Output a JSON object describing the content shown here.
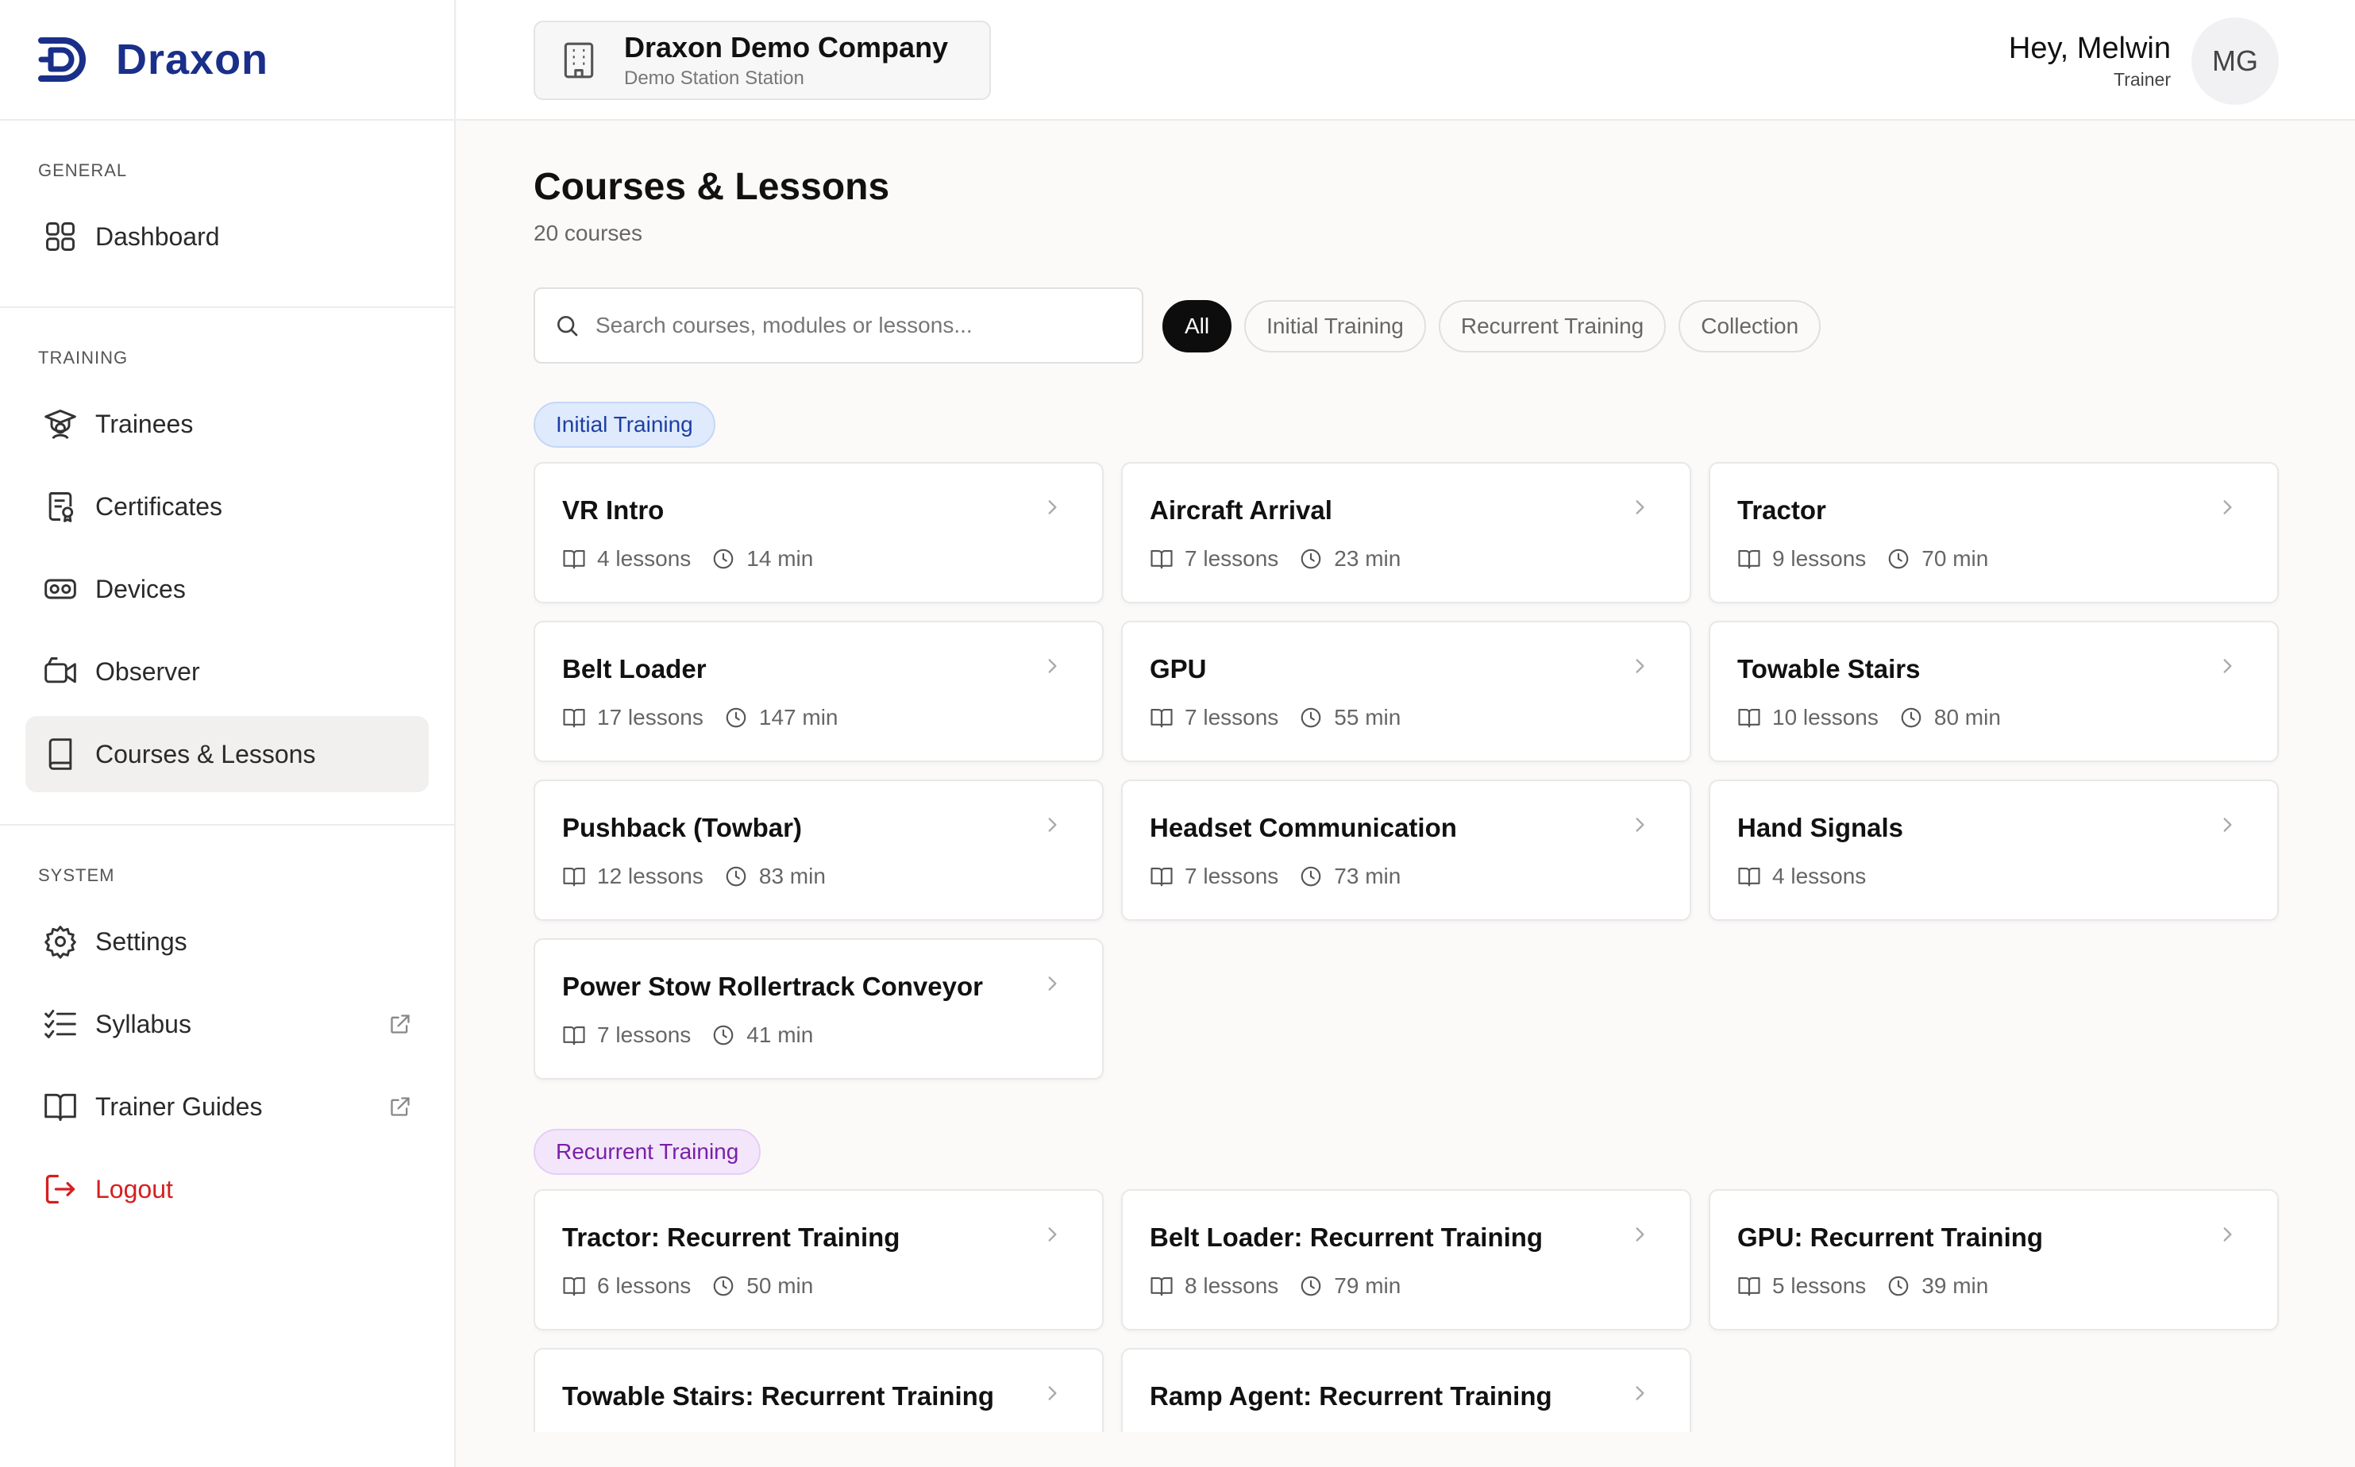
{
  "brand": {
    "name": "Draxon",
    "color": "#1a2f8a"
  },
  "sidebar": {
    "sections": [
      {
        "label": "GENERAL",
        "items": [
          {
            "label": "Dashboard",
            "icon": "grid-icon"
          }
        ]
      },
      {
        "label": "TRAINING",
        "items": [
          {
            "label": "Trainees",
            "icon": "graduation-icon"
          },
          {
            "label": "Certificates",
            "icon": "certificate-icon"
          },
          {
            "label": "Devices",
            "icon": "vr-headset-icon"
          },
          {
            "label": "Observer",
            "icon": "video-camera-icon"
          },
          {
            "label": "Courses & Lessons",
            "icon": "book-icon",
            "active": true
          }
        ]
      },
      {
        "label": "SYSTEM",
        "items": [
          {
            "label": "Settings",
            "icon": "gear-icon"
          },
          {
            "label": "Syllabus",
            "icon": "checklist-icon",
            "external": true
          },
          {
            "label": "Trainer Guides",
            "icon": "open-book-icon",
            "external": true
          },
          {
            "label": "Logout",
            "icon": "logout-icon"
          }
        ]
      }
    ]
  },
  "header": {
    "company_name": "Draxon Demo Company",
    "company_sub": "Demo Station Station",
    "greeting": "Hey, Melwin",
    "role": "Trainer",
    "avatar_initials": "MG"
  },
  "main": {
    "title": "Courses & Lessons",
    "subtitle": "20 courses",
    "search_placeholder": "Search courses, modules or lessons...",
    "filters": [
      "All",
      "Initial Training",
      "Recurrent Training",
      "Collection"
    ],
    "active_filter": "All",
    "groups": [
      {
        "label": "Initial Training",
        "courses": [
          {
            "title": "VR Intro",
            "lessons": "4 lessons",
            "duration": "14 min"
          },
          {
            "title": "Aircraft Arrival",
            "lessons": "7 lessons",
            "duration": "23 min"
          },
          {
            "title": "Tractor",
            "lessons": "9 lessons",
            "duration": "70 min"
          },
          {
            "title": "Belt Loader",
            "lessons": "17 lessons",
            "duration": "147 min"
          },
          {
            "title": "GPU",
            "lessons": "7 lessons",
            "duration": "55 min"
          },
          {
            "title": "Towable Stairs",
            "lessons": "10 lessons",
            "duration": "80 min"
          },
          {
            "title": "Pushback (Towbar)",
            "lessons": "12 lessons",
            "duration": "83 min"
          },
          {
            "title": "Headset Communication",
            "lessons": "7 lessons",
            "duration": "73 min"
          },
          {
            "title": "Hand Signals",
            "lessons": "4 lessons",
            "duration": ""
          },
          {
            "title": "Power Stow Rollertrack Conveyor",
            "lessons": "7 lessons",
            "duration": "41 min"
          }
        ]
      },
      {
        "label": "Recurrent Training",
        "courses": [
          {
            "title": "Tractor: Recurrent Training",
            "lessons": "6 lessons",
            "duration": "50 min"
          },
          {
            "title": "Belt Loader: Recurrent Training",
            "lessons": "8 lessons",
            "duration": "79 min"
          },
          {
            "title": "GPU: Recurrent Training",
            "lessons": "5 lessons",
            "duration": "39 min"
          },
          {
            "title": "Towable Stairs: Recurrent Training",
            "lessons": "",
            "duration": ""
          },
          {
            "title": "Ramp Agent: Recurrent Training",
            "lessons": "",
            "duration": ""
          }
        ]
      }
    ]
  }
}
